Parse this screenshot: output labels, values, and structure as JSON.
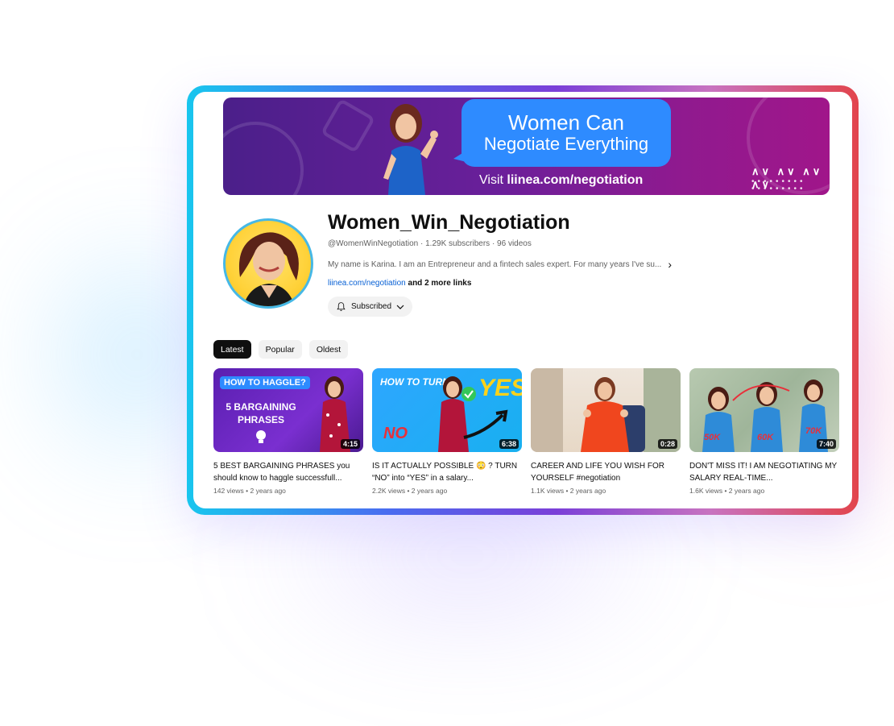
{
  "banner": {
    "headline1": "Women Can",
    "headline2": "Negotiate Everything",
    "visit_prefix": "Visit ",
    "visit_link": "liinea.com/negotiation"
  },
  "channel": {
    "title": "Women_Win_Negotiation",
    "meta": "@WomenWinNegotiation · 1.29K subscribers · 96 videos",
    "description": "My name is Karina. I am an Entrepreneur and a fintech sales expert. For many years I've su...",
    "link": "liinea.com/negotiation",
    "more_links": " and 2 more links",
    "subscribe_label": "Subscribed"
  },
  "chips": [
    {
      "label": "Latest",
      "active": true
    },
    {
      "label": "Popular",
      "active": false
    },
    {
      "label": "Oldest",
      "active": false
    }
  ],
  "videos": [
    {
      "title": "5 BEST BARGAINING PHRASES you should know to haggle successfull...",
      "meta": "142 views • 2 years ago",
      "duration": "4:15",
      "thumb_text1": "HOW TO HAGGLE?",
      "thumb_text2": "5 BARGAINING PHRASES"
    },
    {
      "title": "IS IT ACTUALLY POSSIBLE 😳 ? TURN “NO” into “YES” in a salary...",
      "meta": "2.2K views • 2 years ago",
      "duration": "6:38",
      "thumb_text1": "HOW TO TURN",
      "thumb_text2": "YES",
      "thumb_text3": "NO"
    },
    {
      "title": "CAREER AND LIFE YOU WISH FOR YOURSELF #negotiation",
      "meta": "1.1K views • 2 years ago",
      "duration": "0:28"
    },
    {
      "title": "DON'T MISS IT! I AM NEGOTIATING MY SALARY REAL-TIME...",
      "meta": "1.6K views • 2 years ago",
      "duration": "7:40",
      "thumb_text1": "50K",
      "thumb_text2": "60K",
      "thumb_text3": "70K"
    }
  ]
}
